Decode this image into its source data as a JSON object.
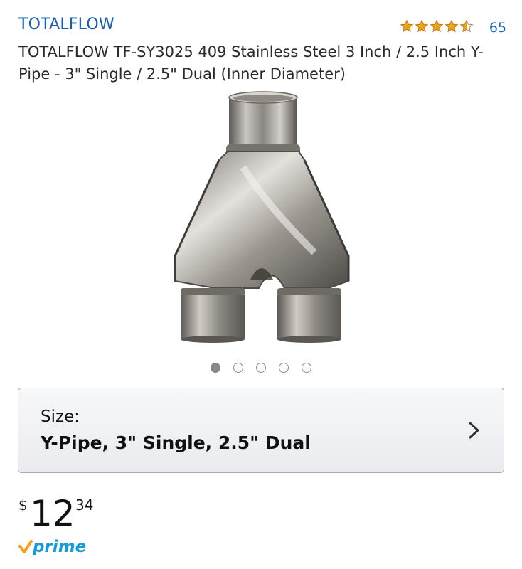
{
  "brand": "TOTALFLOW",
  "rating": {
    "stars": 4.5,
    "count": "65",
    "star_color": "#f0a21c"
  },
  "product": {
    "title": "TOTALFLOW TF-SY3025 409 Stainless Steel 3 Inch / 2.5 Inch Y-Pipe - 3\" Single / 2.5\" Dual (Inner Diameter)",
    "image_icon": "y-pipe-image"
  },
  "carousel": {
    "total": 5,
    "active_index": 0
  },
  "size": {
    "label": "Size:",
    "value": "Y-Pipe, 3\" Single, 2.5\" Dual",
    "icon": "chevron-right-icon"
  },
  "price": {
    "currency": "$",
    "whole": "12",
    "fraction": "34"
  },
  "prime": {
    "text": "prime",
    "color": "#1a9ad6",
    "check_color": "#f0a21c"
  },
  "colors": {
    "link": "#1a5fb4"
  }
}
